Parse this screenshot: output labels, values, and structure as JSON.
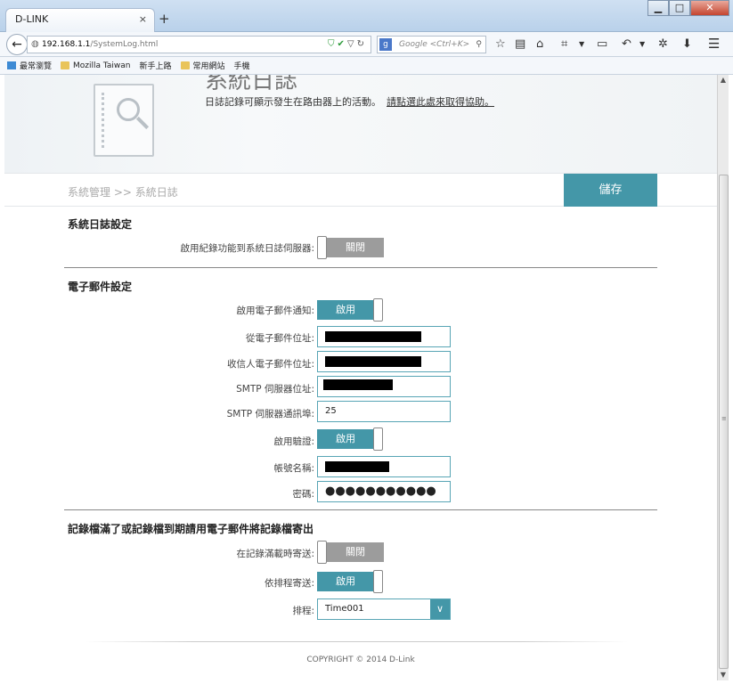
{
  "browser": {
    "tab_title": "D-LINK",
    "tab_close": "×",
    "new_tab": "+",
    "window_buttons": {
      "minimize": "▁",
      "maximize": "□",
      "close": "✕"
    },
    "url_host": "192.168.1.1",
    "url_path": "/SystemLog.html",
    "search_placeholder": "Google <Ctrl+K>",
    "search_engine_icon": "g",
    "bookmarks": [
      {
        "label": "最常瀏覽",
        "icon": "tree-icon"
      },
      {
        "label": "Mozilla Taiwan",
        "icon": "folder-icon"
      },
      {
        "label": "新手上路",
        "icon": "page-icon"
      },
      {
        "label": "常用網站",
        "icon": "folder-icon"
      },
      {
        "label": "手機",
        "icon": "page-icon"
      }
    ]
  },
  "header": {
    "title": "系統日誌",
    "description": "日誌記錄可顯示發生在路由器上的活動。",
    "help_link": "請點選此處來取得協助。"
  },
  "breadcrumb": "系統管理 >> 系統日誌",
  "save_label": "儲存",
  "syslog": {
    "title": "系統日誌設定",
    "enable_label": "啟用紀錄功能到系統日誌伺服器:",
    "enable_state": "關閉"
  },
  "email": {
    "title": "電子郵件設定",
    "enable_label": "啟用電子郵件通知:",
    "enable_state": "啟用",
    "from_label": "從電子郵件位址:",
    "to_label": "收信人電子郵件位址:",
    "smtp_addr_label": "SMTP 伺服器位址:",
    "smtp_port_label": "SMTP 伺服器通訊埠:",
    "smtp_port_value": "25",
    "auth_label": "啟用驗證:",
    "auth_state": "啟用",
    "account_label": "帳號名稱:",
    "password_label": "密碼:",
    "password_value": "●●●●●●●●●●●"
  },
  "logmail": {
    "title": "記錄檔滿了或記錄檔到期請用電子郵件將記錄檔寄出",
    "on_full_label": "在記錄滿載時寄送:",
    "on_full_state": "關閉",
    "on_schedule_label": "依排程寄送:",
    "on_schedule_state": "啟用",
    "schedule_label": "排程:",
    "schedule_value": "Time001"
  },
  "footer": "COPYRIGHT © 2014 D-Link"
}
